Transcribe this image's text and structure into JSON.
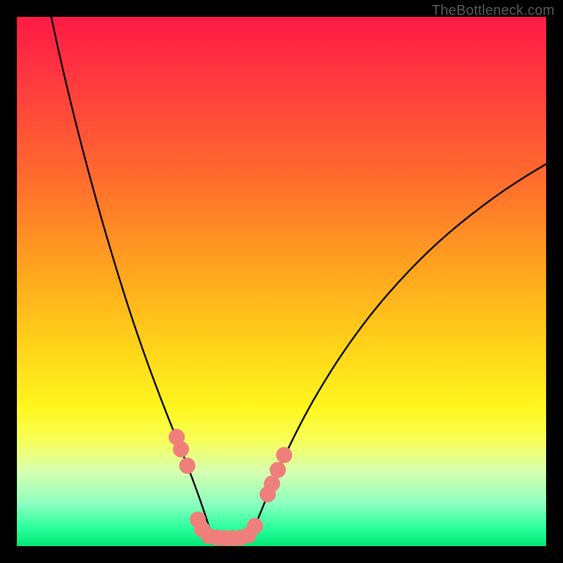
{
  "watermark": "TheBottleneck.com",
  "chart_data": {
    "type": "line",
    "title": "",
    "xlabel": "",
    "ylabel": "",
    "xlim": [
      0,
      100
    ],
    "ylim": [
      0,
      100
    ],
    "grid": false,
    "legend": false,
    "annotations_note": "V-shaped bottleneck curve over red-to-green vertical performance gradient",
    "gradient_stops": [
      {
        "offset": 0.0,
        "color": "#ff1a46"
      },
      {
        "offset": 0.12,
        "color": "#ff3a3f"
      },
      {
        "offset": 0.3,
        "color": "#ff6a2e"
      },
      {
        "offset": 0.48,
        "color": "#ffa51f"
      },
      {
        "offset": 0.62,
        "color": "#ffd21a"
      },
      {
        "offset": 0.74,
        "color": "#fff71f"
      },
      {
        "offset": 0.8,
        "color": "#f8ff5a"
      },
      {
        "offset": 0.86,
        "color": "#d6ffb0"
      },
      {
        "offset": 0.92,
        "color": "#8cffc0"
      },
      {
        "offset": 0.965,
        "color": "#2cff9e"
      },
      {
        "offset": 1.0,
        "color": "#00e874"
      }
    ],
    "series": [
      {
        "name": "left-curve",
        "x": [
          6.5,
          8,
          10,
          12,
          14,
          16,
          18,
          20,
          22,
          24,
          26,
          28,
          29.5,
          31,
          32.5,
          34,
          35.5,
          37
        ],
        "y": [
          100,
          93,
          84.5,
          76.5,
          69,
          61.8,
          55,
          48.5,
          42.3,
          36.5,
          31,
          25.8,
          22,
          18.3,
          14.5,
          10.5,
          6.2,
          1.5
        ]
      },
      {
        "name": "right-curve",
        "x": [
          44,
          46,
          48,
          50,
          53,
          56,
          60,
          64,
          68,
          72,
          76,
          80,
          84,
          88,
          92,
          96,
          100
        ],
        "y": [
          1.5,
          6.2,
          11.2,
          15.8,
          22,
          27.6,
          34.2,
          40,
          45.2,
          49.8,
          54,
          57.8,
          61.2,
          64.3,
          67.2,
          69.8,
          72.2
        ]
      }
    ],
    "marker_groups": [
      {
        "name": "left-branch-upper",
        "color": "#ef7f7a",
        "points": [
          {
            "x": 30.2,
            "y": 20.6
          },
          {
            "x": 31.0,
            "y": 18.3
          },
          {
            "x": 32.2,
            "y": 15.2
          }
        ]
      },
      {
        "name": "bottom-flat",
        "color": "#ef7f7a",
        "points": [
          {
            "x": 34.2,
            "y": 5.0
          },
          {
            "x": 35.0,
            "y": 3.2
          },
          {
            "x": 36.3,
            "y": 1.9
          },
          {
            "x": 37.8,
            "y": 1.6
          },
          {
            "x": 39.3,
            "y": 1.5
          },
          {
            "x": 40.8,
            "y": 1.5
          },
          {
            "x": 42.3,
            "y": 1.6
          },
          {
            "x": 43.8,
            "y": 2.1
          },
          {
            "x": 45.0,
            "y": 3.8
          }
        ]
      },
      {
        "name": "right-branch-lower",
        "color": "#ef7f7a",
        "points": [
          {
            "x": 47.4,
            "y": 9.8
          },
          {
            "x": 48.2,
            "y": 11.8
          },
          {
            "x": 49.3,
            "y": 14.4
          },
          {
            "x": 50.5,
            "y": 17.2
          }
        ]
      }
    ]
  }
}
